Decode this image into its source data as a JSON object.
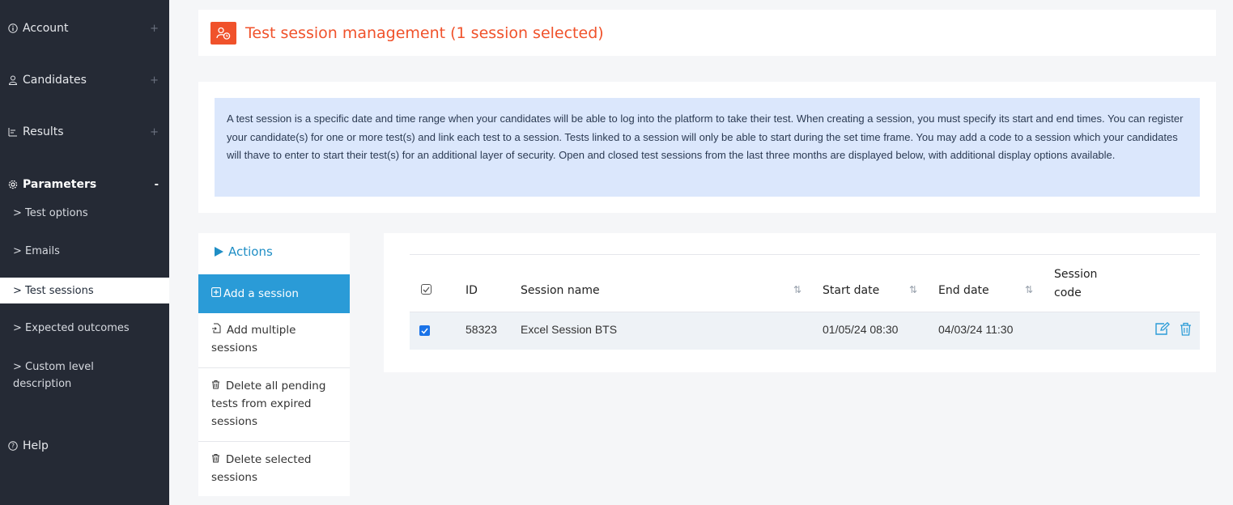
{
  "sidebar": {
    "items": [
      {
        "label": "Account",
        "icon": "info-icon",
        "toggle": "+"
      },
      {
        "label": "Candidates",
        "icon": "user-icon",
        "toggle": "+"
      },
      {
        "label": "Results",
        "icon": "results-icon",
        "toggle": "+"
      },
      {
        "label": "Parameters",
        "icon": "gear-icon",
        "toggle": "-"
      }
    ],
    "subitems": [
      "> Test options",
      "> Emails",
      "> Test sessions",
      "> Expected outcomes",
      "> Custom level description"
    ],
    "help": "Help"
  },
  "header": {
    "title": "Test session management (1 session selected)"
  },
  "info": {
    "text": "A test session is a specific date and time range when your candidates will be able to log into the platform to take their test. When creating a session, you must specify its start and end times. You can register your candidate(s) for one or more test(s) and link each test to a session. Tests linked to a session will only be able to start during the set time frame. You may add a code to a session which your candidates will thave to enter to start their test(s) for an additional layer of security. Open and closed test sessions from the last three months are displayed below, with additional display options available."
  },
  "actions": {
    "title": "Actions",
    "add_session": "Add a session",
    "add_multiple": "Add multiple sessions",
    "delete_pending": "Delete all pending tests from expired sessions",
    "delete_selected": "Delete selected sessions"
  },
  "table": {
    "headers": {
      "id": "ID",
      "name": "Session name",
      "start": "Start date",
      "end": "End date",
      "code": "Session code"
    },
    "rows": [
      {
        "id": "58323",
        "name": "Excel Session BTS",
        "start": "01/05/24 08:30",
        "end": "04/03/24 11:30",
        "code": "",
        "selected": true
      }
    ]
  },
  "colors": {
    "accent": "#f0522b",
    "primary": "#2a9bd7",
    "sidebar": "#252a35"
  }
}
